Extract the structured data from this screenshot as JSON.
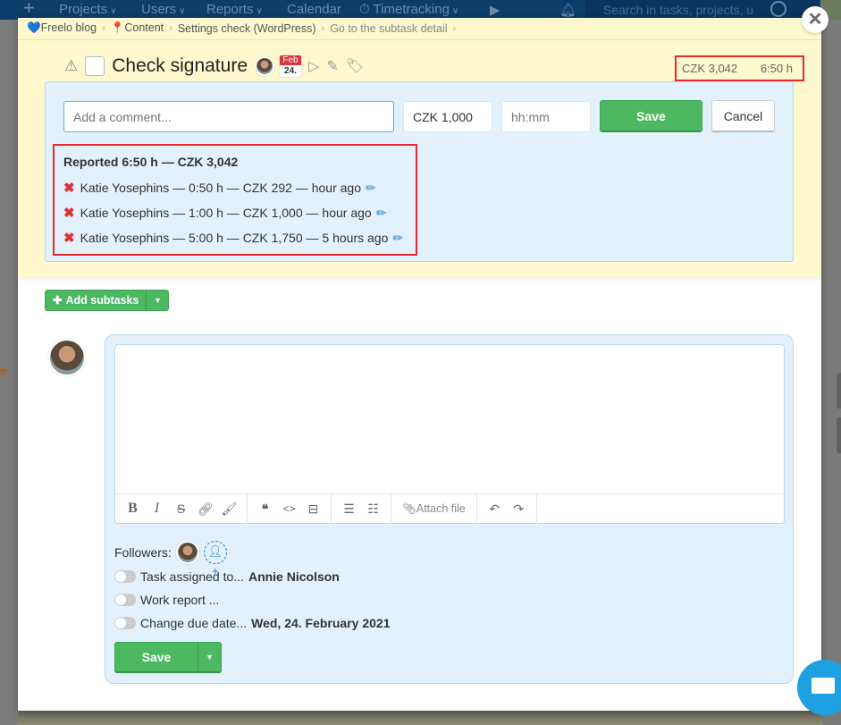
{
  "topnav": {
    "items": [
      "Projects",
      "Users",
      "Reports",
      "Calendar",
      "Timetracking"
    ],
    "search_placeholder": "Search in tasks, projects, u"
  },
  "breadcrumb": {
    "project": "Freelo blog",
    "tasklist": "Content",
    "task": "Settings check (WordPress)",
    "link": "Go to the subtask detail",
    "separator": "›"
  },
  "task": {
    "title": "Check signature",
    "due_month": "Feb",
    "due_day": "24."
  },
  "totals": {
    "amount": "CZK 3,042",
    "time": "6:50 h"
  },
  "report_form": {
    "comment_placeholder": "Add a comment...",
    "amount_value": "CZK 1,000",
    "time_placeholder": "hh:mm",
    "save_label": "Save",
    "cancel_label": "Cancel"
  },
  "reports": {
    "heading": "Reported 6:50 h — CZK 3,042",
    "rows": [
      {
        "text": "Katie Yosephins — 0:50 h — CZK 292 — hour ago"
      },
      {
        "text": "Katie Yosephins — 1:00 h — CZK 1,000 — hour ago"
      },
      {
        "text": "Katie Yosephins — 5:00 h — CZK 1,750 — 5 hours ago"
      }
    ]
  },
  "subtasks": {
    "add_label": "Add subtasks"
  },
  "editor": {
    "attach_label": "Attach file"
  },
  "comment_options": {
    "followers_label": "Followers:",
    "assigned_label": "Task assigned to...",
    "assigned_value": "Annie Nicolson",
    "work_report_label": "Work report ...",
    "due_date_label": "Change due date...",
    "due_date_value": "Wed, 24. February 2021",
    "save_label": "Save"
  },
  "colors": {
    "accent_green": "#4cb862",
    "highlight_red": "#e52a2a",
    "header_yellow": "#fdf8cd",
    "panel_blue": "#e3f1fc",
    "link_blue": "#1e7fd8"
  }
}
